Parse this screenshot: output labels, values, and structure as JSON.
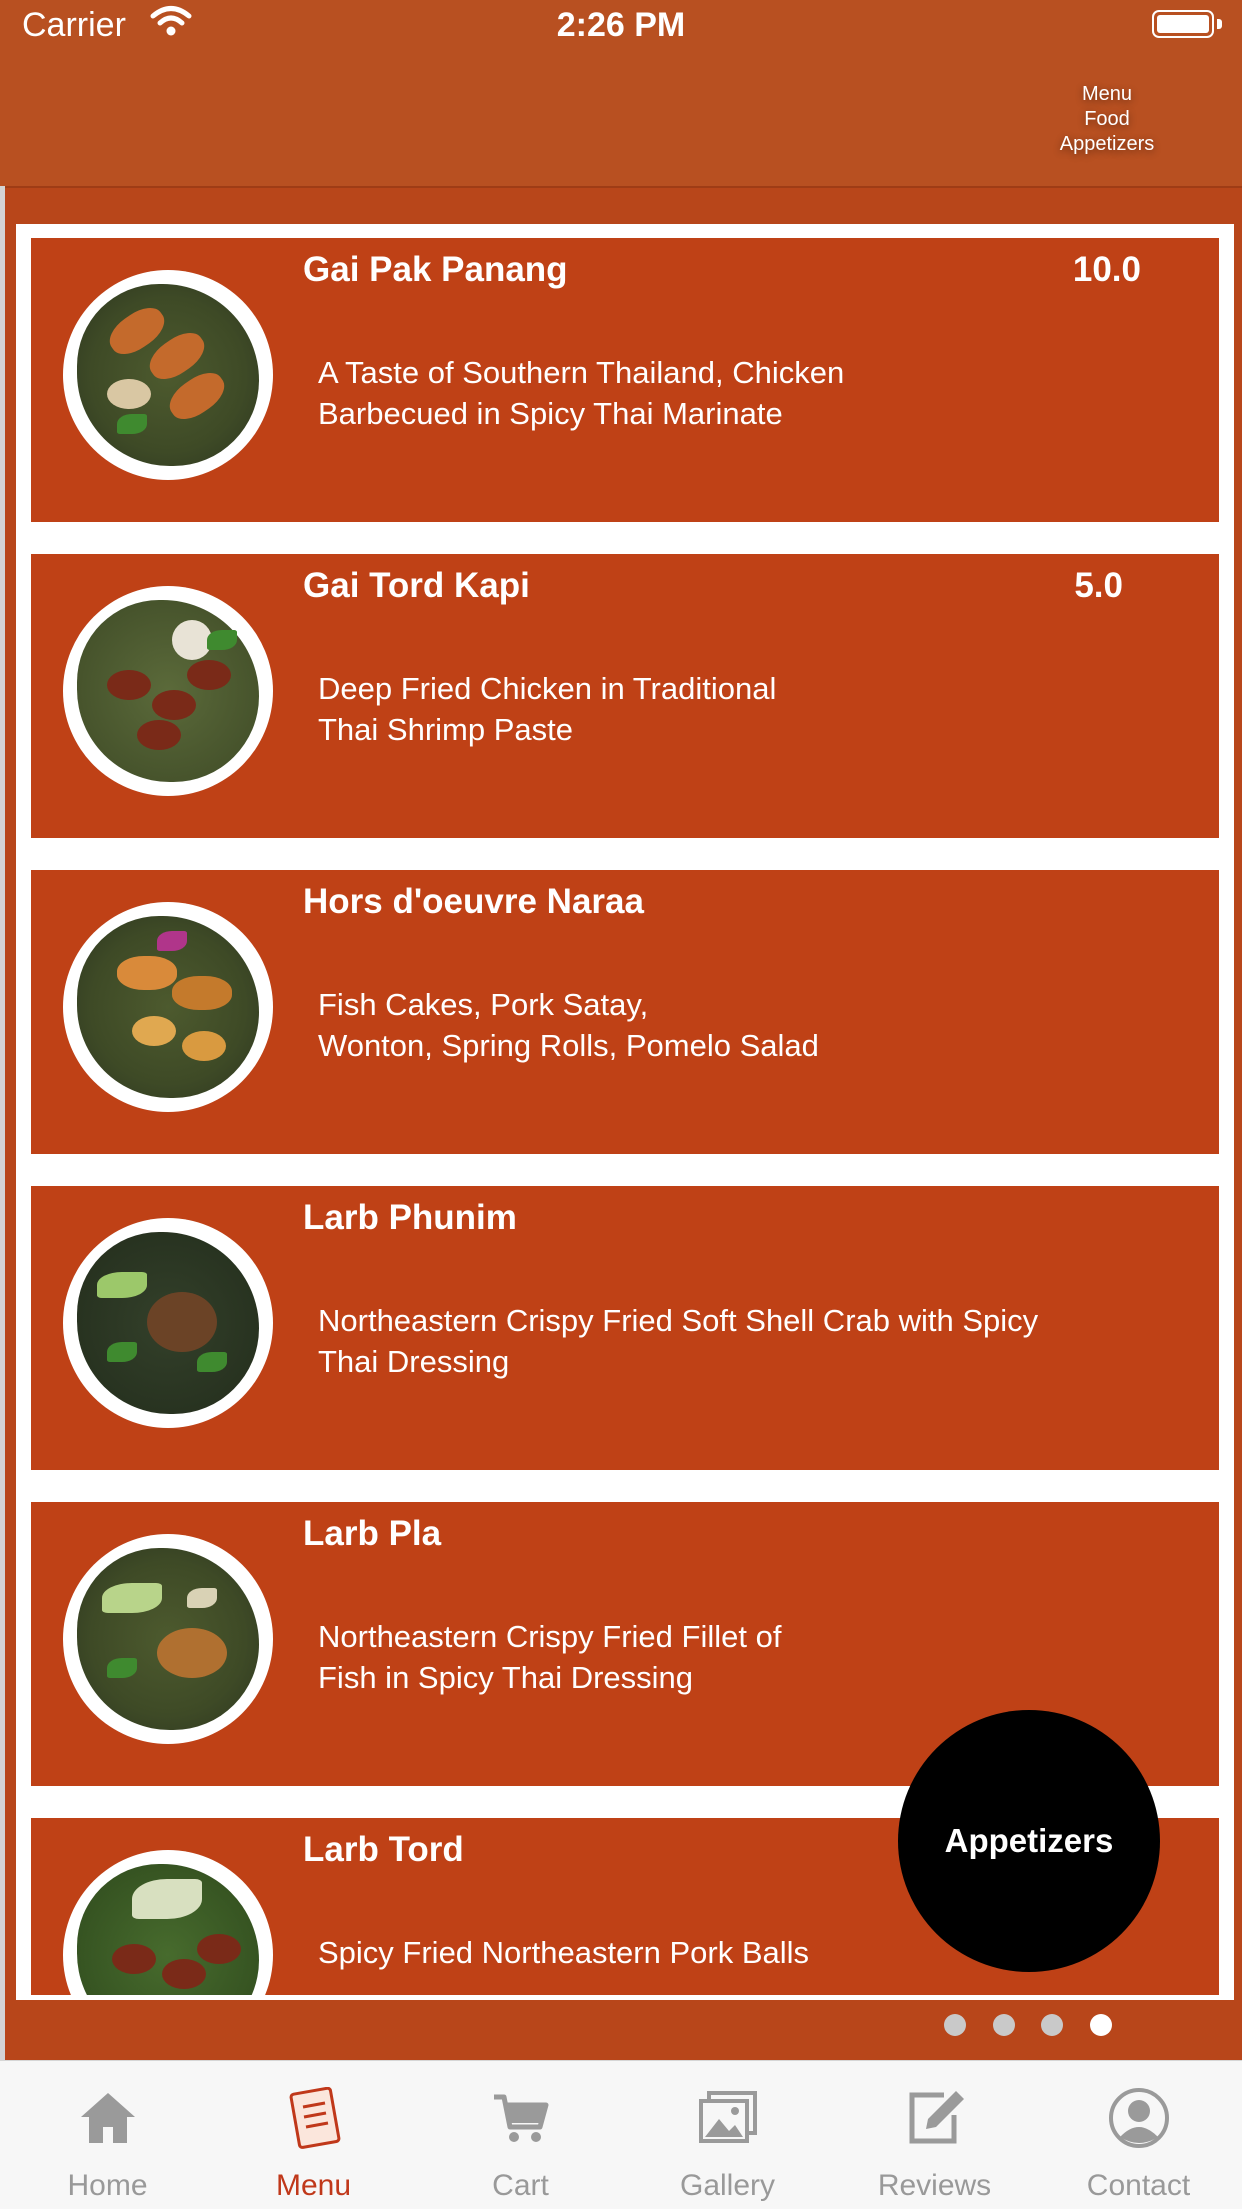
{
  "status": {
    "carrier": "Carrier",
    "time": "2:26 PM"
  },
  "breadcrumb": {
    "line1": "Menu",
    "line2": "Food",
    "line3": "Appetizers"
  },
  "items": [
    {
      "name": "Gai Pak Panang",
      "price": "10.0",
      "desc1": "A Taste of Southern Thailand, Chicken",
      "desc2": "Barbecued in Spicy Thai Marinate"
    },
    {
      "name": "Gai Tord Kapi",
      "price": "5.0",
      "desc1": "Deep Fried Chicken in Traditional",
      "desc2": "Thai Shrimp Paste"
    },
    {
      "name": "Hors d'oeuvre Naraa",
      "price": "",
      "desc1": "Fish Cakes, Pork Satay,",
      "desc2": "Wonton, Spring Rolls, Pomelo Salad"
    },
    {
      "name": "Larb Phunim",
      "price": "",
      "desc1": "Northeastern Crispy Fried Soft Shell Crab with Spicy",
      "desc2": "Thai Dressing"
    },
    {
      "name": "Larb Pla",
      "price": "",
      "desc1": "Northeastern Crispy Fried Fillet of",
      "desc2": "Fish in Spicy Thai Dressing"
    },
    {
      "name": "Larb Tord",
      "price": "",
      "desc1": "Spicy Fried Northeastern Pork Balls",
      "desc2": ""
    }
  ],
  "fab": {
    "label": "Appetizers"
  },
  "pager": {
    "pages": 4,
    "current": 4
  },
  "tabs": [
    {
      "label": "Home",
      "icon": "home-icon"
    },
    {
      "label": "Menu",
      "icon": "menu-book-icon",
      "active": true
    },
    {
      "label": "Cart",
      "icon": "cart-icon"
    },
    {
      "label": "Gallery",
      "icon": "gallery-icon"
    },
    {
      "label": "Reviews",
      "icon": "pencil-icon"
    },
    {
      "label": "Contact",
      "icon": "person-icon"
    }
  ],
  "colors": {
    "accent": "#c0381a",
    "card": "#bf4116",
    "navbar": "#b85021"
  }
}
